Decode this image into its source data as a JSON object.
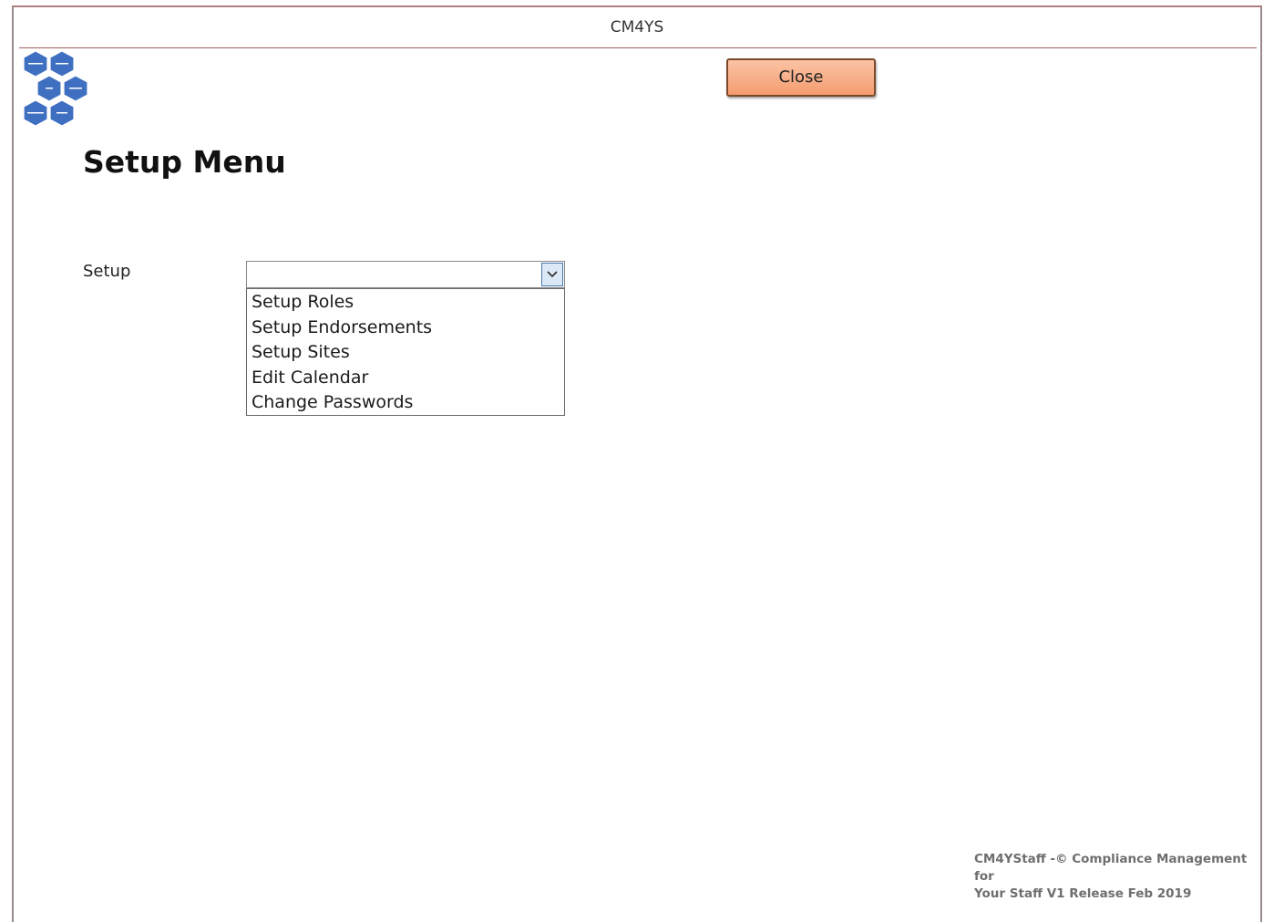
{
  "window": {
    "title": "CM4YS"
  },
  "toolbar": {
    "close_label": "Close"
  },
  "page": {
    "title": "Setup Menu"
  },
  "setup": {
    "label": "Setup",
    "selected_value": "",
    "options": [
      "Setup Roles",
      "Setup Endorsements",
      "Setup Sites",
      "Edit Calendar",
      "Change Passwords"
    ]
  },
  "footer": {
    "line1": "CM4YStaff -© Compliance Management for",
    "line2": "Your Staff  V1 Release Feb 2019"
  },
  "colors": {
    "close_button_fill": "#f49c70",
    "logo_hex_fill": "#3f6fc0",
    "window_border": "#9a8a8a",
    "title_rule": "#a06060"
  },
  "icons": {
    "logo": "hexagon-cluster-logo",
    "dropdown": "chevron-down-icon"
  }
}
